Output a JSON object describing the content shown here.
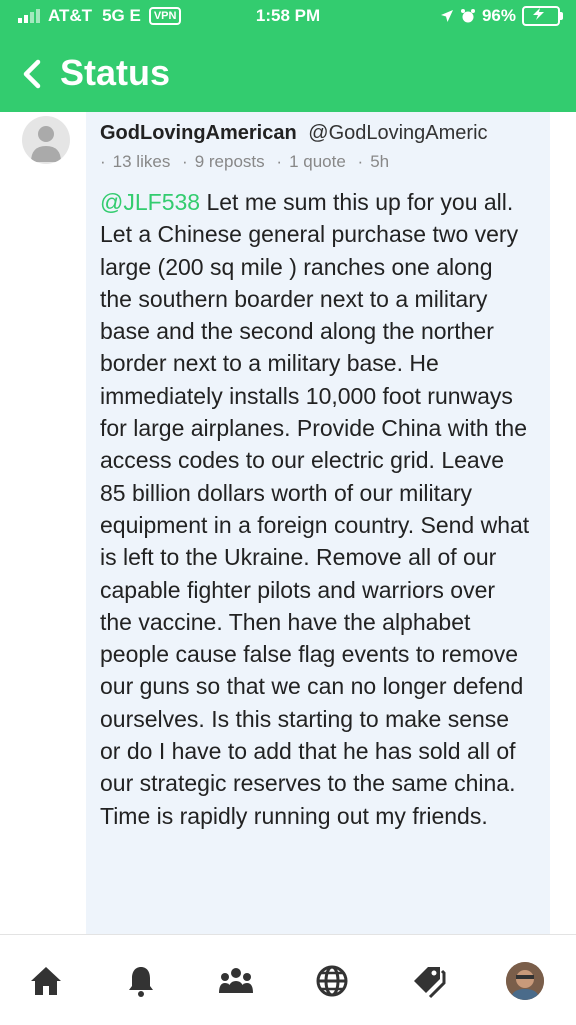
{
  "status_bar": {
    "carrier": "AT&T",
    "network": "5G E",
    "vpn": "VPN",
    "time": "1:58 PM",
    "battery": "96%"
  },
  "nav": {
    "title": "Status"
  },
  "post": {
    "display_name": "GodLovingAmerican",
    "handle": "@GodLovingAmeric",
    "stats": {
      "likes": "13 likes",
      "reposts": "9 reposts",
      "quotes": "1 quote",
      "age": "5h"
    },
    "mention": "@JLF538",
    "body": " Let me sum this up for you all. Let a Chinese general purchase two very large (200 sq mile ) ranches one along the southern boarder next to a military base and the second along the norther border next to a military base. He immediately installs 10,000 foot runways for large airplanes. Provide China with the access codes to our electric grid. Leave 85 billion dollars worth of our military equipment in a foreign country. Send what is left to the Ukraine. Remove all of our capable fighter pilots and warriors over the vaccine. Then have the alphabet people cause false flag events to remove our guns so that we can no longer defend ourselves. Is this starting to make sense or do I have to add that he has sold all of our strategic reserves to the same china. Time is rapidly running out my friends."
  },
  "tabbar": {
    "items": [
      "home-icon",
      "bell-icon",
      "people-icon",
      "globe-icon",
      "tag-icon",
      "profile-avatar"
    ]
  },
  "colors": {
    "accent": "#33cc6f",
    "post_bg": "#eef4fb",
    "meta": "#888888"
  }
}
